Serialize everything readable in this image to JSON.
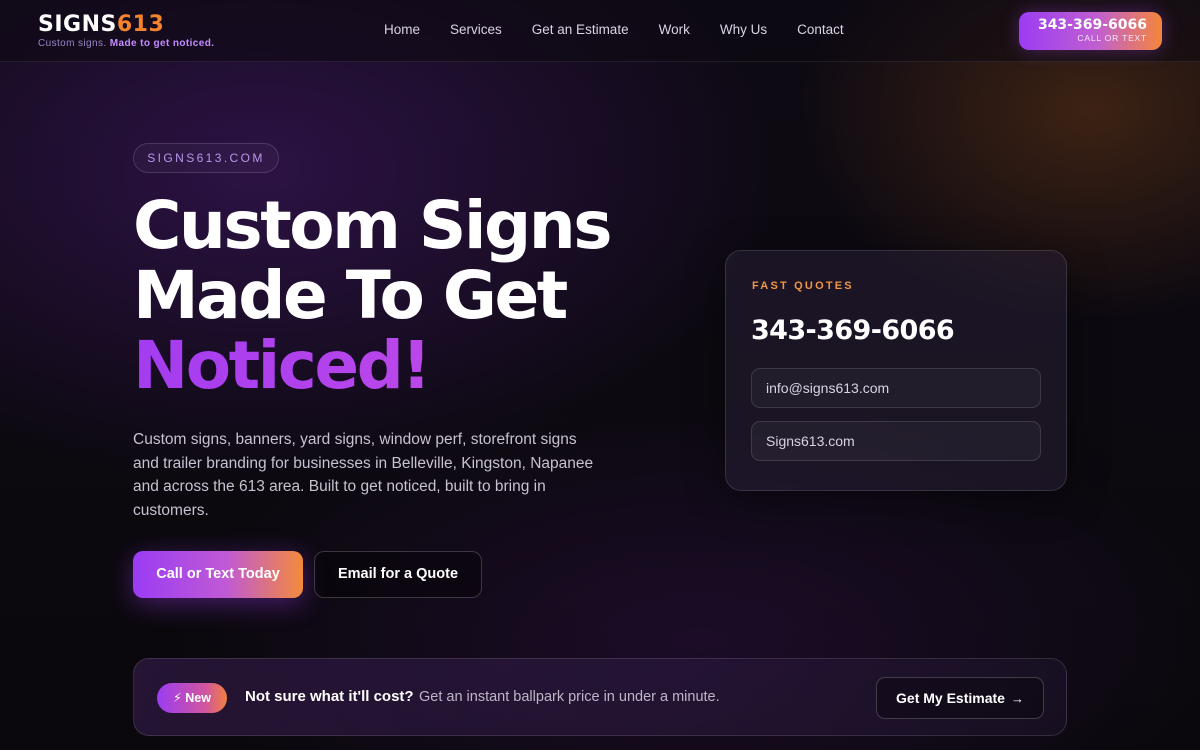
{
  "header": {
    "logo": {
      "word_primary": "SIGNS",
      "word_accent": "613",
      "tagline": "Custom signs.",
      "tagline_highlight": "Made to get noticed."
    },
    "nav": [
      "Home",
      "Services",
      "Get an Estimate",
      "Work",
      "Why Us",
      "Contact"
    ],
    "phone_button": {
      "number": "343-369-6066",
      "sub": "CALL OR TEXT"
    }
  },
  "hero": {
    "pill": "SIGNS613.COM",
    "headline_line1": "Custom Signs",
    "headline_line2": "Made To Get",
    "headline_line3": "Noticed!",
    "lead": "Custom signs, banners, yard signs, window perf, storefront signs and trailer branding for businesses in Belleville, Kingston, Napanee and across the 613 area. Built to get noticed, built to bring in customers.",
    "cta_primary": "Call or Text Today",
    "cta_secondary": "Email for a Quote"
  },
  "quote_card": {
    "label": "FAST QUOTES",
    "phone": "343-369-6066",
    "email": "info@signs613.com",
    "website": "Signs613.com"
  },
  "estimate_banner": {
    "badge_icon": "⚡",
    "badge": "New",
    "question": "Not sure what it'll cost?",
    "text": "Get an instant ballpark price in under a minute.",
    "button": "Get My Estimate",
    "button_arrow": "→"
  },
  "colors": {
    "accent_purple": "#9b3cf3",
    "accent_orange": "#f5822c",
    "background": "#0b090f"
  }
}
